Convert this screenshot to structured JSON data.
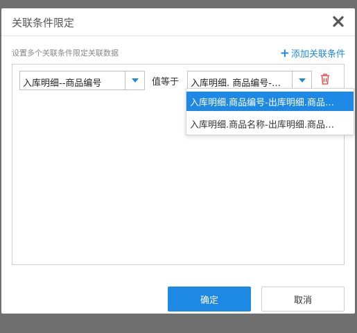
{
  "dialog": {
    "title": "关联条件限定",
    "subtitle": "设置多个关联条件限定关联数据",
    "add_condition_label": "添加关联条件",
    "ok_label": "确定",
    "cancel_label": "取消"
  },
  "condition": {
    "left_field": "入库明细--商品编号",
    "operator_label": "值等于",
    "right_field": "入库明细. 商品编号-…"
  },
  "dropdown": {
    "options": [
      "入库明细.商品编号-出库明细.商品…",
      "入库明细.商品名称-出库明细.商品…"
    ],
    "selected_index": 0
  },
  "colors": {
    "accent": "#1e88e5",
    "delete": "#e53935",
    "overlay": "#6f6f6f"
  },
  "icons": [
    "close-icon",
    "plus-icon",
    "chevron-down-icon",
    "trash-icon"
  ]
}
